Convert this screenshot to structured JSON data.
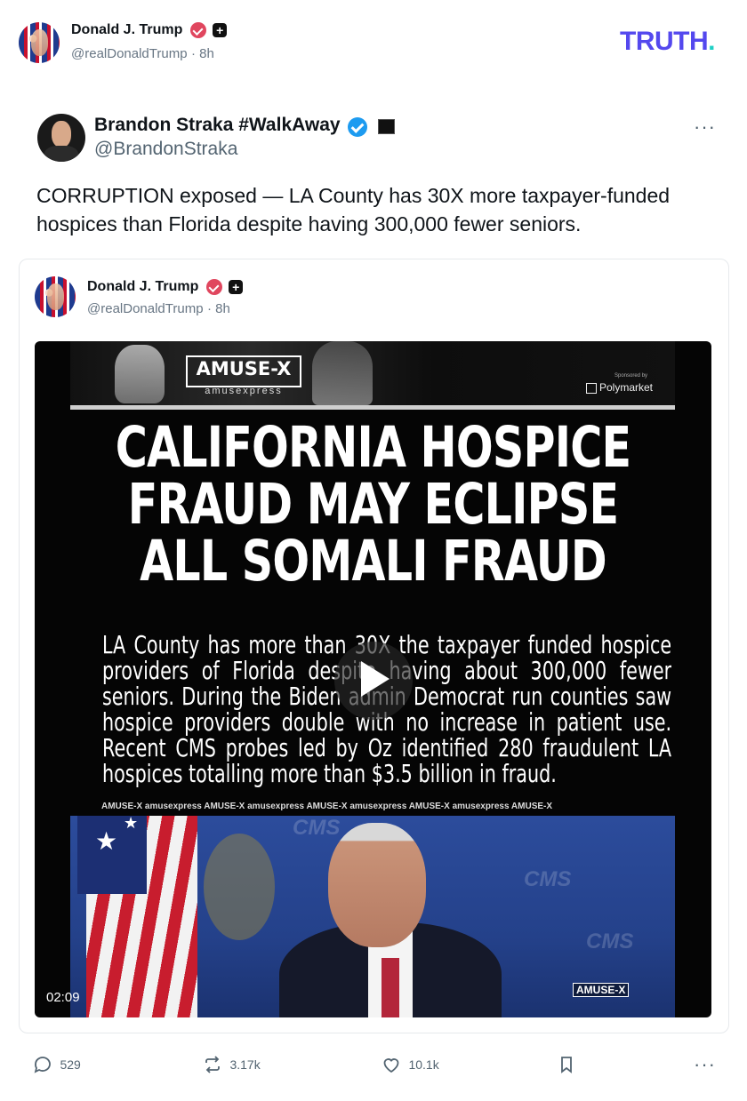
{
  "post": {
    "author": {
      "name": "Donald J. Trump",
      "handle": "@realDonaldTrump",
      "time": "· 8h"
    },
    "logo": {
      "text": "TRUTH",
      "dot": "."
    }
  },
  "quoted_post": {
    "author": {
      "name": "Brandon Straka #WalkAway",
      "handle": "@BrandonStraka"
    },
    "more_label": "···",
    "text": "CORRUPTION exposed — LA County has 30X more taxpayer-funded hospices than Florida despite having 300,000 fewer seniors."
  },
  "embedded_post": {
    "author": {
      "name": "Donald J. Trump",
      "handle": "@realDonaldTrump",
      "time": "· 8h"
    },
    "video": {
      "brand": "AMUSE-X",
      "brand_sub": "amusexpress",
      "sponsor_small": "Sponsored by",
      "sponsor": "Polymarket",
      "headline_1": "CALIFORNIA HOSPICE",
      "headline_2": "FRAUD MAY ECLIPSE",
      "headline_3": "ALL SOMALI FRAUD",
      "body": "LA County has more than 30X the taxpayer funded hospice providers of Florida despite having about 300,000 fewer seniors. During the Biden admin Democrat run counties saw hospice providers double with no increase in patient use. Recent CMS probes led by Oz identified 280 fraudulent LA hospices totalling more than $3.5 billion in fraud.",
      "ticker": "AMUSE-X  amusexpress  AMUSE-X  amusexpress  AMUSE-X  amusexpress  AMUSE-X  amusexpress  AMUSE-X",
      "bg_watermark": "CMS",
      "duration": "02:09"
    }
  },
  "actions": {
    "replies": "529",
    "retruths": "3.17k",
    "likes": "10.1k",
    "more": "···"
  },
  "colors": {
    "brand": "#5448ee",
    "accent": "#1fd0c5",
    "verified": "#1d9bf0",
    "badge_red": "#e0465e"
  }
}
